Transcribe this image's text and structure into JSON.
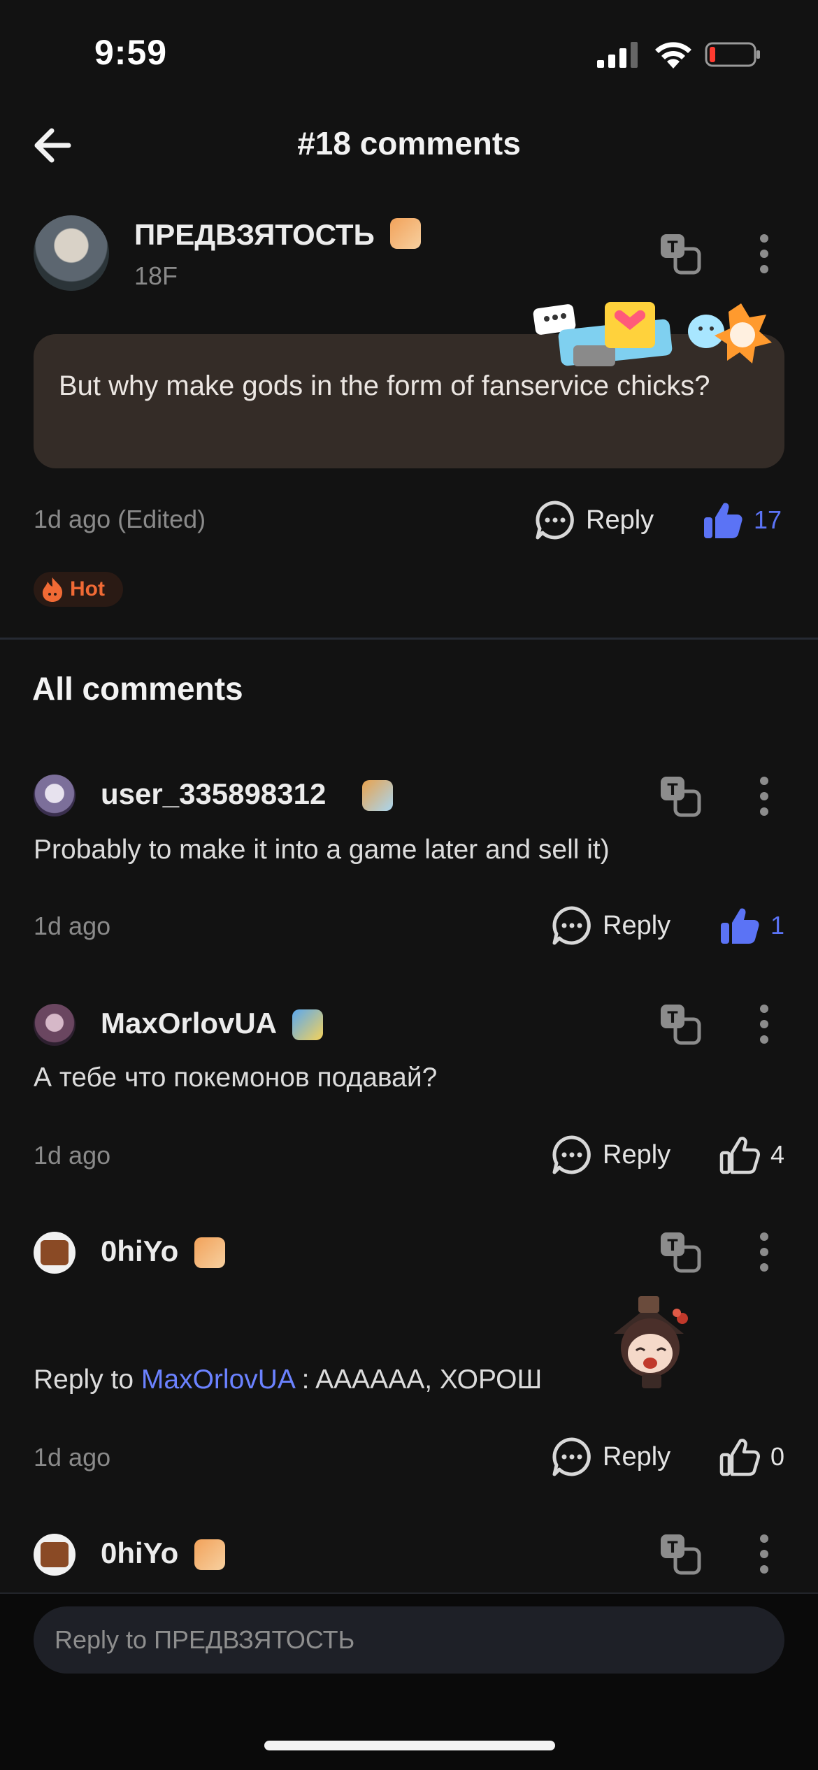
{
  "status_bar": {
    "time": "9:59"
  },
  "header": {
    "title": "#18 comments"
  },
  "main_comment": {
    "author": "ПРЕДВЗЯТОСТЬ",
    "floor": "18F",
    "text": "But why make gods in the form of fanservice chicks?",
    "time": "1d ago (Edited)",
    "reply_label": "Reply",
    "likes": "17",
    "hot_label": "Hot"
  },
  "all_comments_title": "All comments",
  "comments": [
    {
      "author": "user_335898312",
      "text": "Probably to make it into a game later and sell it)",
      "time": "1d ago",
      "reply_label": "Reply",
      "likes": "1"
    },
    {
      "author": "MaxOrlovUA",
      "text": "А тебе что покемонов подавай?",
      "time": "1d ago",
      "reply_label": "Reply",
      "likes": "4"
    },
    {
      "author": "0hiYo",
      "reply_prefix": "Reply to ",
      "reply_target": "MaxOrlovUA",
      "text": " : AAAAAA, ХОРОШ",
      "time": "1d ago",
      "reply_label": "Reply",
      "likes": "0"
    },
    {
      "author": "0hiYo"
    }
  ],
  "reply_input": {
    "placeholder": "Reply to ПРЕДВЗЯТОСТЬ"
  },
  "colors": {
    "accent": "#5b73f5",
    "hot": "#f06a35",
    "bubble": "#342c27",
    "background": "#121212"
  }
}
